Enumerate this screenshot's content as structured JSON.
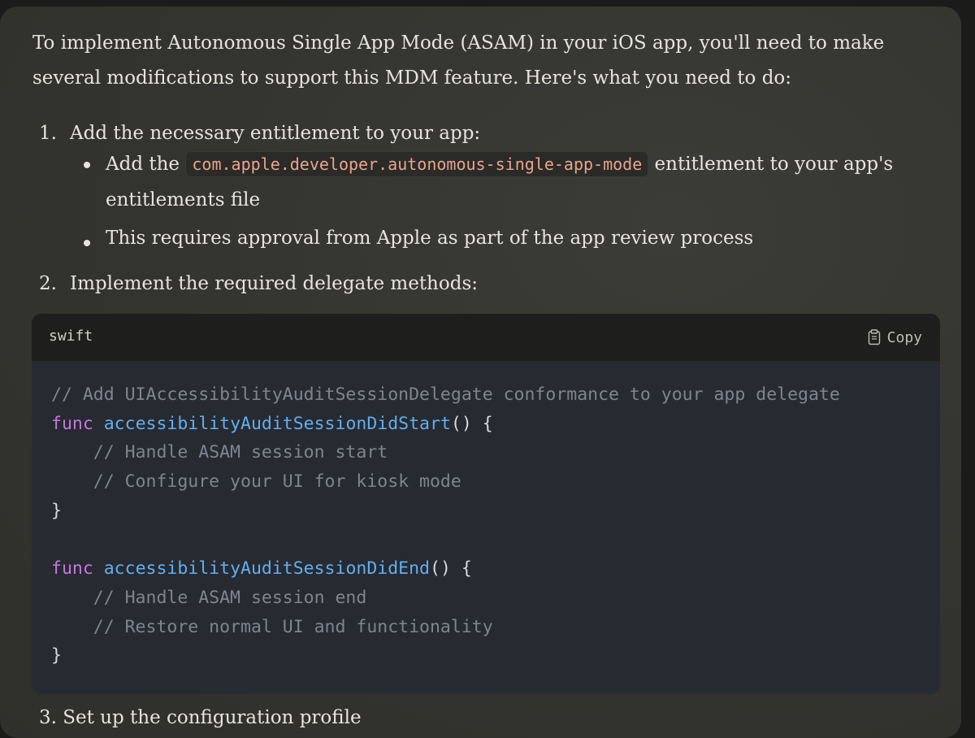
{
  "intro": "To implement Autonomous Single App Mode (ASAM) in your iOS app, you'll need to make several modifications to support this MDM feature. Here's what you need to do:",
  "steps": [
    {
      "number": "1.",
      "text": "Add the necessary entitlement to your app:",
      "bullets": [
        {
          "before": "Add the ",
          "code": "com.apple.developer.autonomous-single-app-mode",
          "after": " entitlement to your app's entitlements file"
        },
        {
          "text": "This requires approval from Apple as part of the app review process"
        }
      ]
    },
    {
      "number": "2.",
      "text": "Implement the required delegate methods:"
    },
    {
      "number": "3.",
      "text": "Set up the configuration profile"
    }
  ],
  "code_block": {
    "language": "swift",
    "copy_label": "Copy",
    "copy_icon": "clipboard-icon",
    "lines": [
      [
        {
          "t": "// Add UIAccessibilityAuditSessionDelegate conformance to your app delegate",
          "c": "comment"
        }
      ],
      [
        {
          "t": "func",
          "c": "keyword"
        },
        {
          "t": " ",
          "c": "punct"
        },
        {
          "t": "accessibilityAuditSessionDidStart",
          "c": "func"
        },
        {
          "t": "() {",
          "c": "punct"
        }
      ],
      [
        {
          "t": "    // Handle ASAM session start",
          "c": "comment"
        }
      ],
      [
        {
          "t": "    // Configure your UI for kiosk mode",
          "c": "comment"
        }
      ],
      [
        {
          "t": "}",
          "c": "punct"
        }
      ],
      [],
      [
        {
          "t": "func",
          "c": "keyword"
        },
        {
          "t": " ",
          "c": "punct"
        },
        {
          "t": "accessibilityAuditSessionDidEnd",
          "c": "func"
        },
        {
          "t": "() {",
          "c": "punct"
        }
      ],
      [
        {
          "t": "    // Handle ASAM session end",
          "c": "comment"
        }
      ],
      [
        {
          "t": "    // Restore normal UI and functionality",
          "c": "comment"
        }
      ],
      [
        {
          "t": "}",
          "c": "punct"
        }
      ]
    ]
  }
}
